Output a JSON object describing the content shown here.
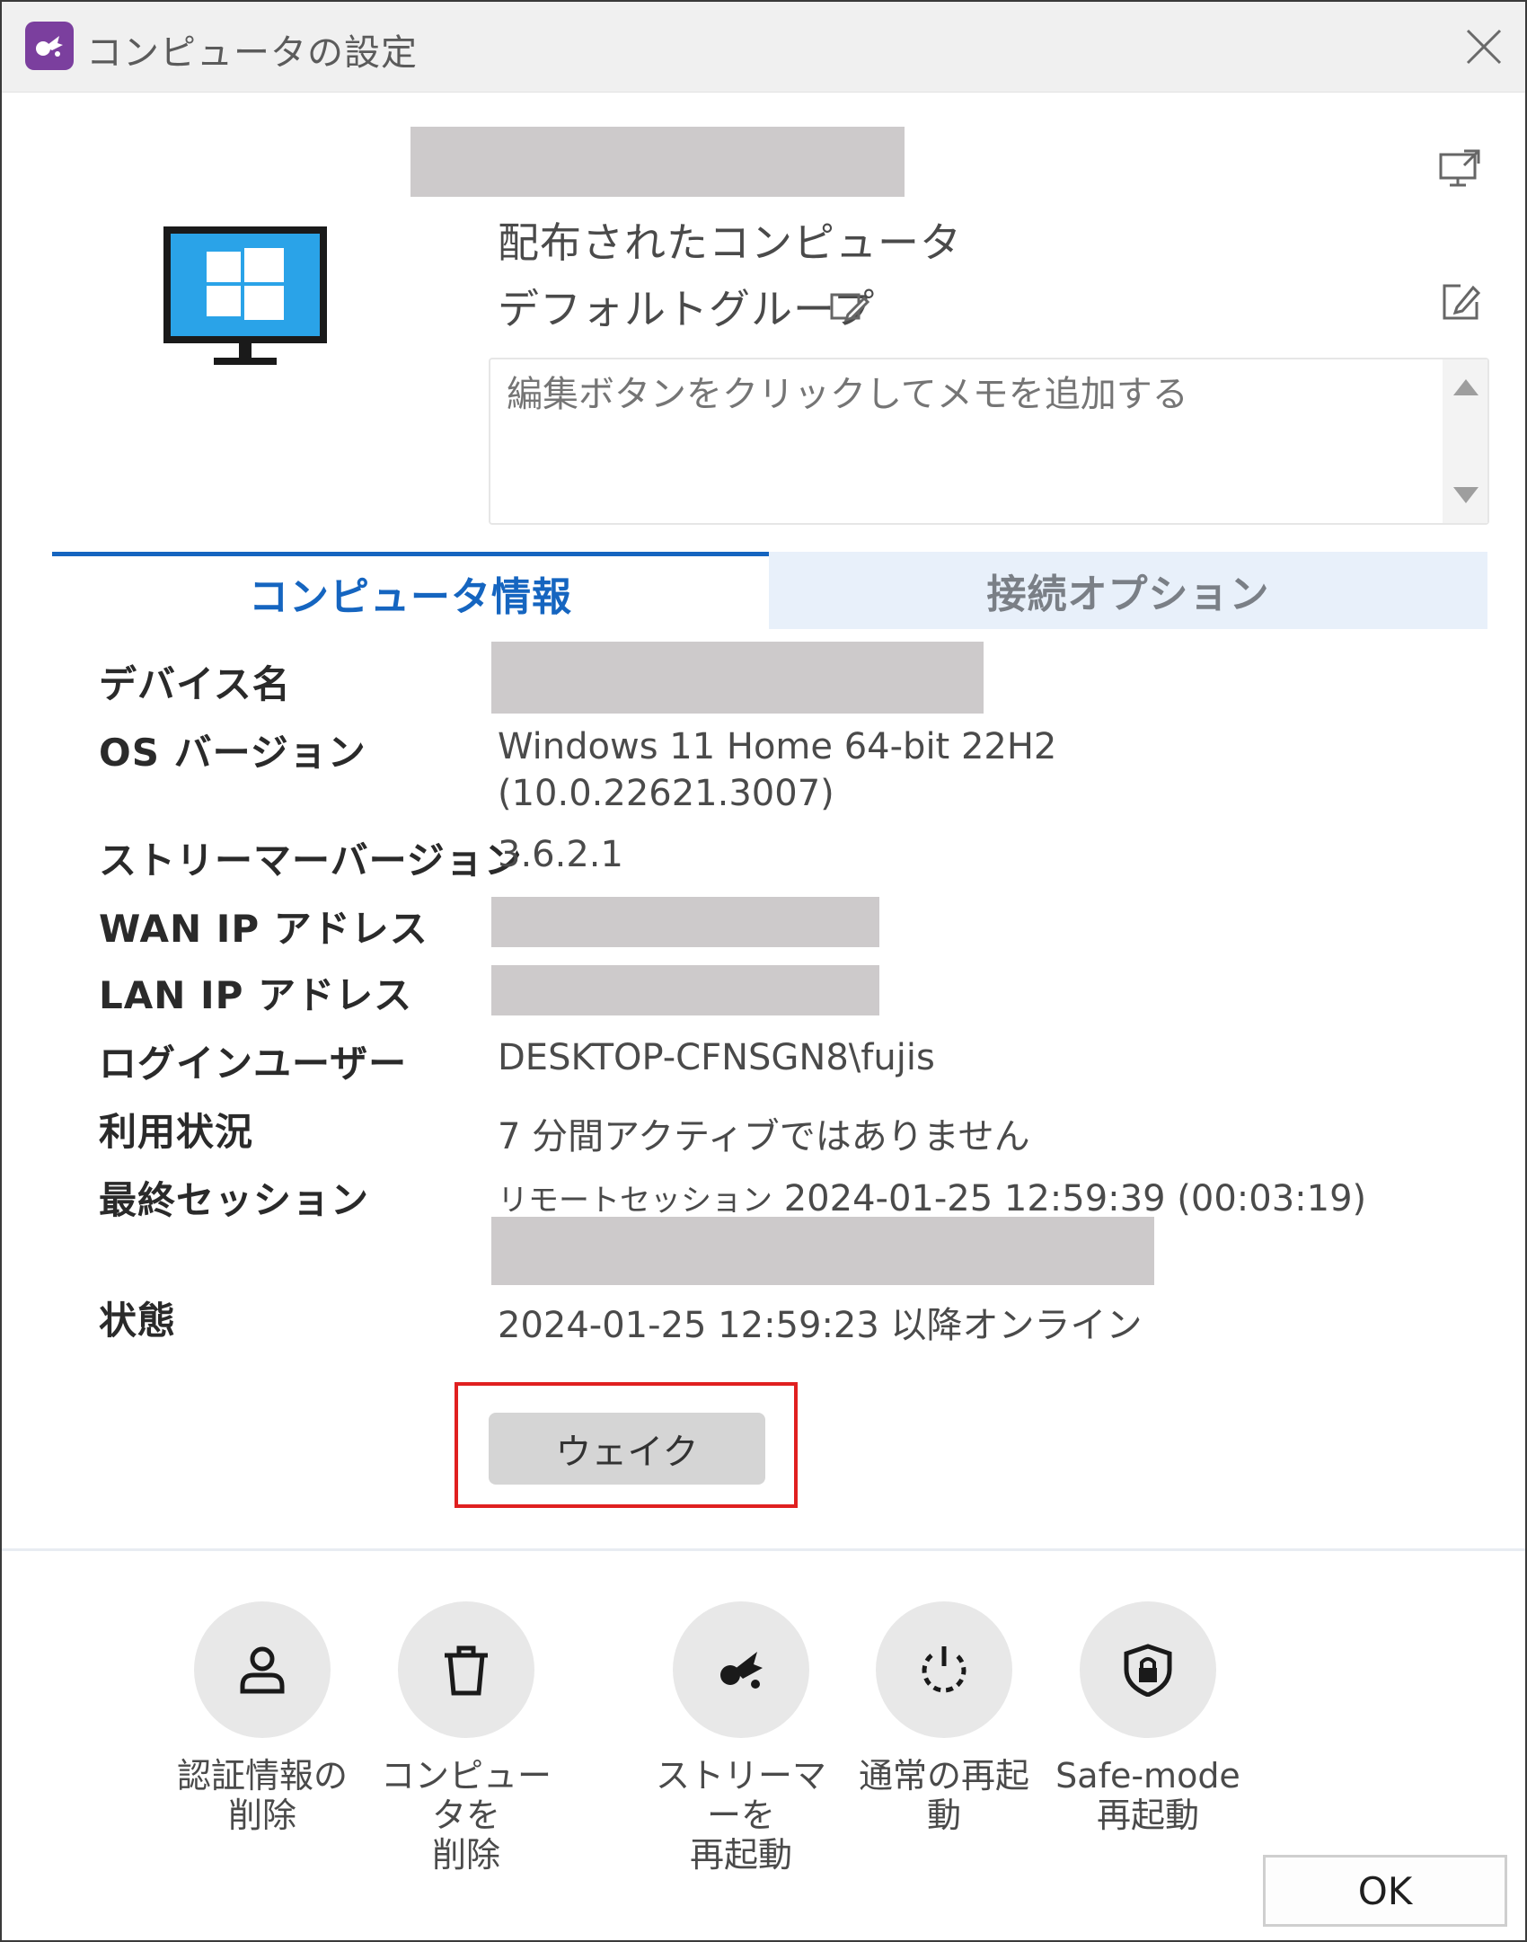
{
  "window": {
    "title": "コンピュータの設定",
    "app_icon": "splashtop-logo-icon",
    "close_icon": "close-icon"
  },
  "header": {
    "line1": "配布されたコンピュータ",
    "group": "デフォルトグループ",
    "group_icon": "edit-group-icon",
    "popout_icon": "open-external-icon",
    "edit_icon": "edit-icon",
    "monitor_icon": "windows-monitor-icon"
  },
  "memo": {
    "placeholder": "編集ボタンをクリックしてメモを追加する"
  },
  "tabs": [
    {
      "label": "コンピュータ情報",
      "active": true
    },
    {
      "label": "接続オプション",
      "active": false
    }
  ],
  "info": {
    "device_name": {
      "label": "デバイス名"
    },
    "os_version": {
      "label": "OS バージョン",
      "value_line1": "Windows 11 Home 64-bit 22H2",
      "value_line2": "(10.0.22621.3007)"
    },
    "streamer_version": {
      "label": "ストリーマーバージョン",
      "value": "3.6.2.1"
    },
    "wan_ip": {
      "label": "WAN IP アドレス"
    },
    "lan_ip": {
      "label": "LAN IP アドレス"
    },
    "login_user": {
      "label": "ログインユーザー",
      "value": "DESKTOP-CFNSGN8\\fujis"
    },
    "usage": {
      "label": "利用状況",
      "value": "7 分間アクティブではありません"
    },
    "last_session": {
      "label": "最終セッション",
      "prefix": "リモートセッション",
      "value": "2024-01-25 12:59:39 (00:03:19)"
    },
    "status": {
      "label": "状態",
      "value": "2024-01-25 12:59:23 以降オンライン"
    }
  },
  "wake_button": {
    "label": "ウェイク"
  },
  "actions": [
    {
      "line1": "認証情報の",
      "line2": "削除",
      "icon": "user-icon"
    },
    {
      "line1": "コンピュータを",
      "line2": "削除",
      "icon": "trash-icon"
    },
    {
      "line1": "ストリーマーを",
      "line2": "再起動",
      "icon": "splashtop-streamer-icon"
    },
    {
      "line1": "通常の再起",
      "line2": "動",
      "icon": "power-restart-icon"
    },
    {
      "line1": "Safe-mode",
      "line2": "再起動",
      "icon": "shield-lock-icon"
    }
  ],
  "ok_button": {
    "label": "OK"
  },
  "colors": {
    "accent": "#1565c0",
    "highlight": "#e02020",
    "redaction": "#cdcacb"
  }
}
